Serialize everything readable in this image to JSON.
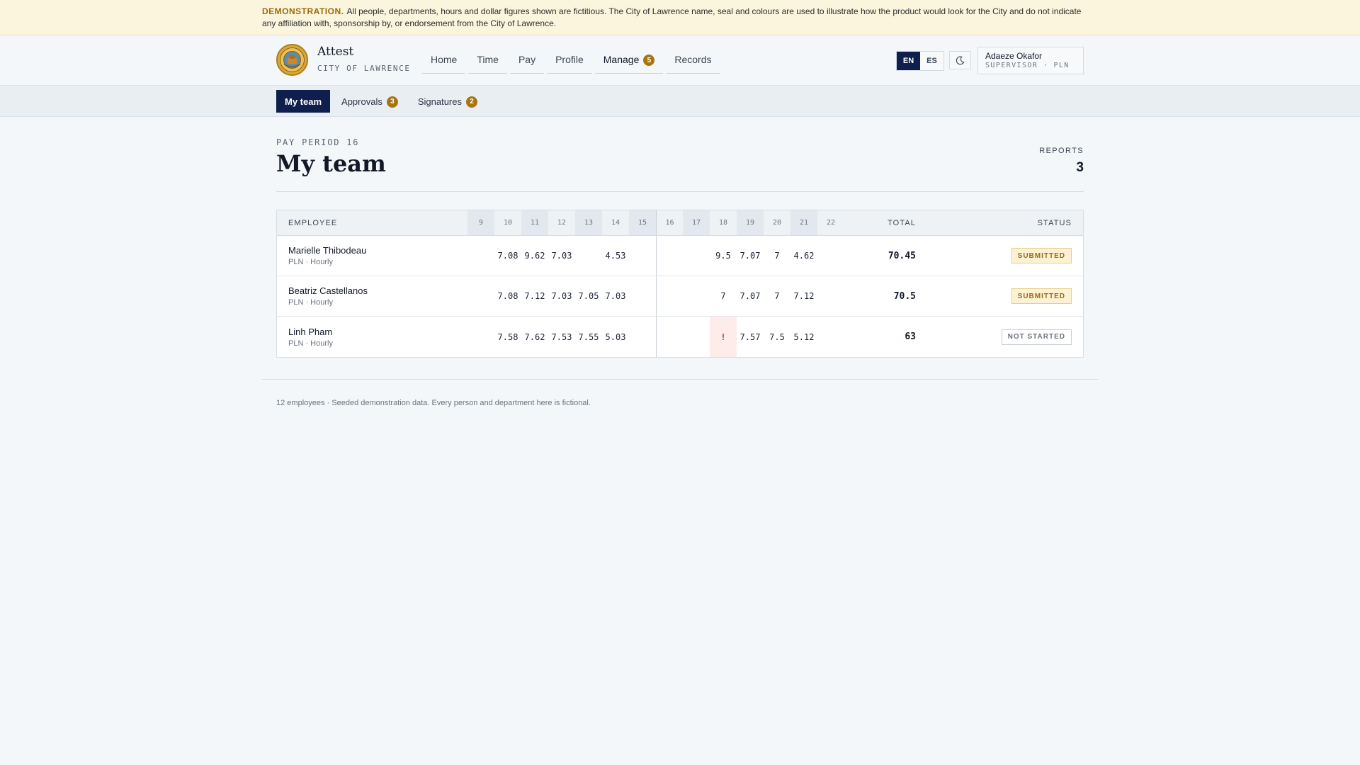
{
  "banner": {
    "tag": "DEMONSTRATION.",
    "text": "All people, departments, hours and dollar figures shown are fictitious. The City of Lawrence name, seal and colours are used to illustrate how the product would look for the City and do not indicate any affiliation with, sponsorship by, or endorsement from the City of Lawrence."
  },
  "header": {
    "app_name": "Attest",
    "org_name": "CITY OF LAWRENCE",
    "nav": [
      {
        "label": "Home"
      },
      {
        "label": "Time"
      },
      {
        "label": "Pay"
      },
      {
        "label": "Profile"
      },
      {
        "label": "Manage",
        "badge": "5"
      },
      {
        "label": "Records"
      }
    ],
    "lang": {
      "en": "EN",
      "es": "ES",
      "active": "EN"
    },
    "user": {
      "name": "Adaeze Okafor",
      "role": "SUPERVISOR · PLN"
    }
  },
  "subnav": [
    {
      "label": "My team",
      "active": true
    },
    {
      "label": "Approvals",
      "badge": "3"
    },
    {
      "label": "Signatures",
      "badge": "2"
    }
  ],
  "page": {
    "period_label": "PAY PERIOD 16",
    "title": "My team",
    "reports_label": "REPORTS",
    "reports_value": "3"
  },
  "table": {
    "col_employee": "EMPLOYEE",
    "col_total": "TOTAL",
    "col_status": "STATUS",
    "days": [
      "9",
      "10",
      "11",
      "12",
      "13",
      "14",
      "15",
      "16",
      "17",
      "18",
      "19",
      "20",
      "21",
      "22"
    ],
    "rows": [
      {
        "name": "Marielle Thibodeau",
        "meta": "PLN · Hourly",
        "hours": [
          "",
          "7.08",
          "9.62",
          "7.03",
          "",
          "4.53",
          "",
          "",
          "",
          "9.5",
          "7.07",
          "7",
          "4.62",
          ""
        ],
        "total": "70.45",
        "status": "SUBMITTED"
      },
      {
        "name": "Beatriz Castellanos",
        "meta": "PLN · Hourly",
        "hours": [
          "",
          "7.08",
          "7.12",
          "7.03",
          "7.05",
          "7.03",
          "",
          "",
          "",
          "7",
          "7.07",
          "7",
          "7.12",
          ""
        ],
        "total": "70.5",
        "status": "SUBMITTED"
      },
      {
        "name": "Linh Pham",
        "meta": "PLN · Hourly",
        "hours": [
          "",
          "7.58",
          "7.62",
          "7.53",
          "7.55",
          "5.03",
          "",
          "",
          "",
          "!",
          "7.57",
          "7.5",
          "5.12",
          ""
        ],
        "total": "63",
        "status": "NOT STARTED"
      }
    ]
  },
  "footer": {
    "note": "12 employees · Seeded demonstration data. Every person and department here is fictional."
  }
}
